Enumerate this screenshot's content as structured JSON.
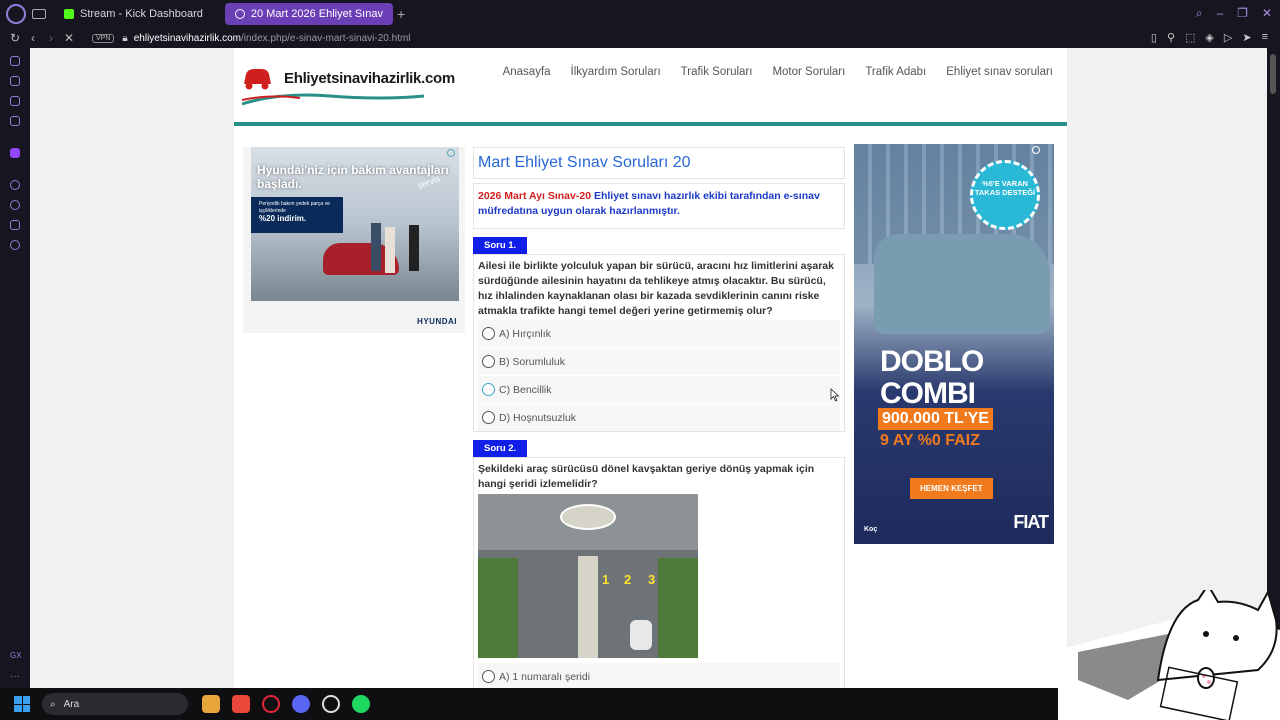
{
  "browser": {
    "tabs": [
      {
        "label": "Stream - Kick Dashboard",
        "active": false,
        "color": "#53fc18"
      },
      {
        "label": "20 Mart 2026 Ehliyet Sınav",
        "active": true,
        "color": "#ffffff"
      }
    ],
    "new_tab": "+",
    "vpn_label": "VPN",
    "url_host": "ehliyetsinavihazirlik.com",
    "url_path": "/index.php/e-sinav-mart-sinavi-20.html",
    "sidebar_gx": "GX",
    "sidebar_more": "···"
  },
  "site": {
    "logo_text": "Ehliyetsinavihazirlik.com",
    "nav": [
      "Anasayfa",
      "İlkyardım Soruları",
      "Trafik Soruları",
      "Motor Soruları",
      "Trafik Adabı",
      "Ehliyet sınav soruları"
    ]
  },
  "ad_left": {
    "title": "Hyundai'niz için bakım avantajları başladı.",
    "box_text": "Periyodik bakım yedek parça ve işçiliklerinde",
    "box_pct": "%20 indirim.",
    "servis": "servis",
    "brand": "HYUNDAI"
  },
  "content": {
    "title": "Mart Ehliyet Sınav Soruları 20",
    "intro_year": "2026 Mart Ayı Sınav-20",
    "intro_rest": " Ehliyet sınavı hazırlık ekibi tarafından e-sınav müfredatına uygun olarak hazırlanmıştır.",
    "questions": [
      {
        "label": "Soru 1.",
        "text": "Ailesi ile birlikte yolculuk yapan bir sürücü, aracını hız limitlerini aşarak sürdüğünde ailesinin hayatını da tehlikeye atmış olacaktır. Bu sürücü, hız ihlalinden kaynaklanan olası bir kazada sevdiklerinin canını riske atmakla trafikte hangi temel değeri yerine getirmemiş olur?",
        "options": [
          "A) Hırçınlık",
          "B) Sorumluluk",
          "C) Bencillik",
          "D) Hoşnutsuzluk"
        ]
      },
      {
        "label": "Soru 2.",
        "text": "Şekildeki araç sürücüsü dönel kavşaktan geriye dönüş yapmak için hangi şeridi izlemelidir?",
        "lane_numbers": [
          "1",
          "2",
          "3"
        ],
        "options": [
          "A) 1 numaralı şeridi"
        ]
      }
    ]
  },
  "ad_right": {
    "badge": "%5'E VARAN TAKAS DESTEĞİ",
    "model_line1": "DOBLO",
    "model_line2": "COMBI",
    "price": "900.000 TL'YE",
    "rate": "9 AY %0 FAIZ",
    "cta": "HEMEN KEŞFET",
    "dealer": "Koç",
    "brand": "FIAT"
  },
  "taskbar": {
    "search_placeholder": "Ara"
  },
  "colors": {
    "accent_purple": "#6b3fb5",
    "site_teal": "#2a8f87",
    "question_label_blue": "#1020e8",
    "title_blue": "#2768d6",
    "intro_red": "#d0201e"
  }
}
